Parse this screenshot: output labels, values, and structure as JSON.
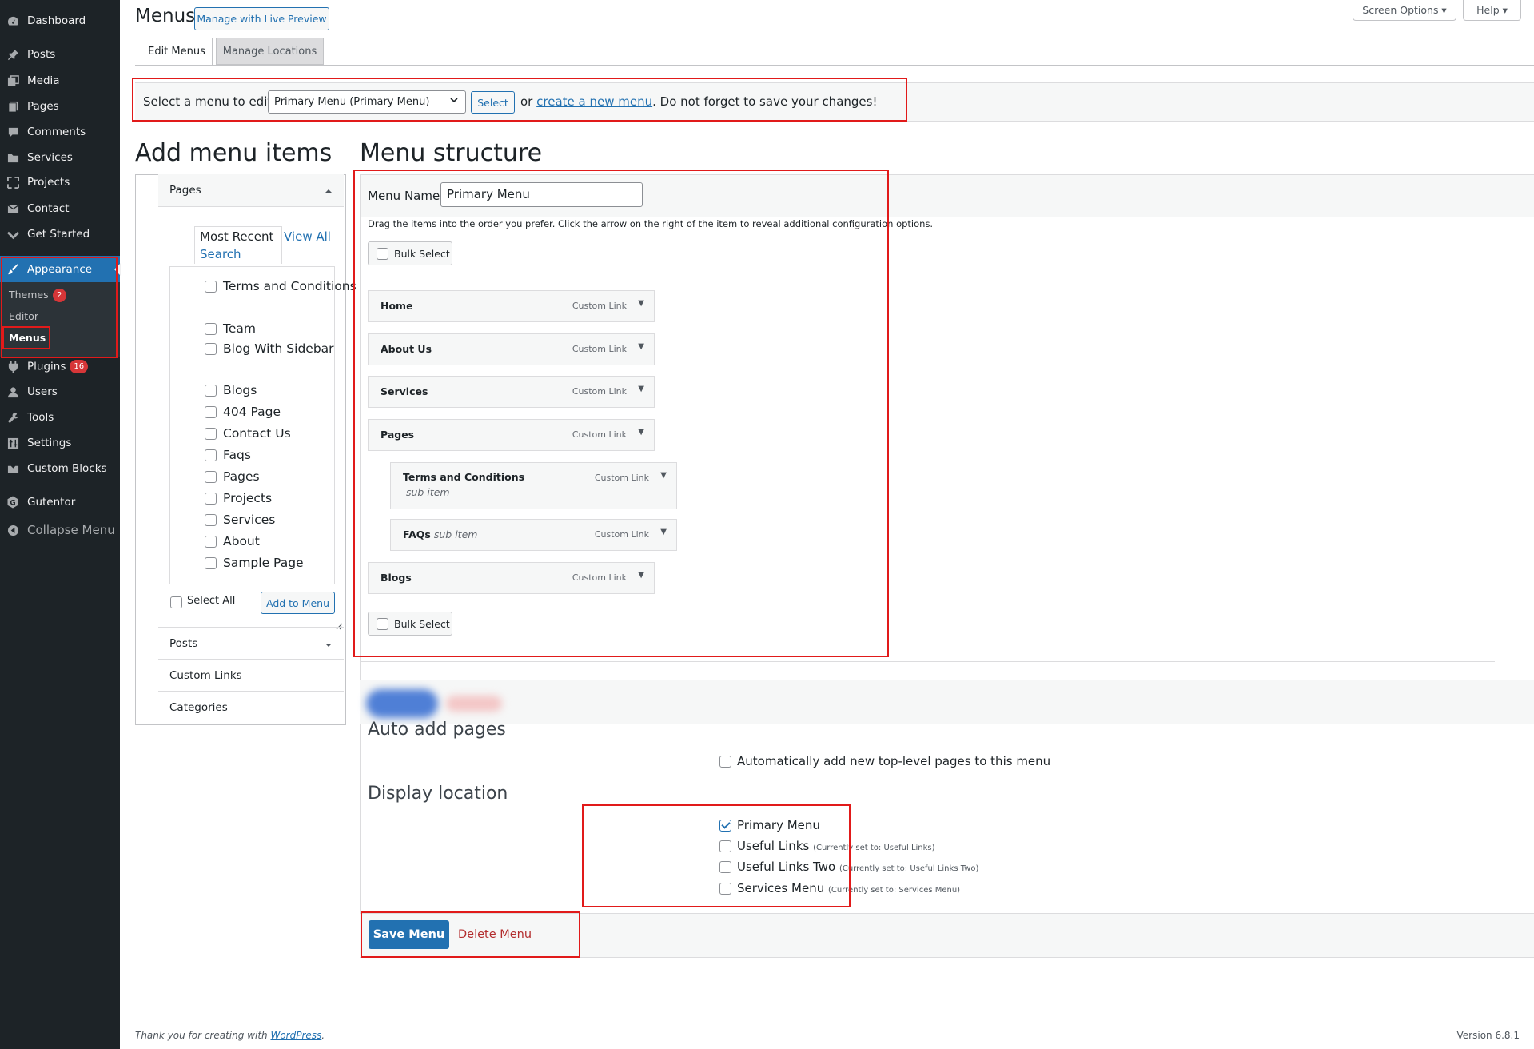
{
  "sidebar": {
    "items": [
      {
        "label": "Dashboard",
        "icon": "dashboard-icon"
      },
      {
        "label": "Posts",
        "icon": "pushpin-icon"
      },
      {
        "label": "Media",
        "icon": "media-icon"
      },
      {
        "label": "Pages",
        "icon": "pages-icon"
      },
      {
        "label": "Comments",
        "icon": "comment-icon"
      },
      {
        "label": "Services",
        "icon": "folder-icon"
      },
      {
        "label": "Projects",
        "icon": "expand-icon"
      },
      {
        "label": "Contact",
        "icon": "envelope-icon"
      },
      {
        "label": "Get Started",
        "icon": "chevron-down-icon"
      },
      {
        "label": "Appearance",
        "icon": "paintbrush-icon"
      },
      {
        "label": "Plugins",
        "icon": "plug-icon",
        "badge": "16"
      },
      {
        "label": "Users",
        "icon": "user-icon"
      },
      {
        "label": "Tools",
        "icon": "wrench-icon"
      },
      {
        "label": "Settings",
        "icon": "settings-icon"
      },
      {
        "label": "Custom Blocks",
        "icon": "blocks-icon"
      },
      {
        "label": "Gutentor",
        "icon": "gutentor-icon"
      },
      {
        "label": "Collapse Menu",
        "icon": "collapse-icon"
      }
    ],
    "submenu": [
      {
        "label": "Themes",
        "badge": "2"
      },
      {
        "label": "Editor"
      },
      {
        "label": "Menus",
        "current": true
      }
    ]
  },
  "header": {
    "title": "Menus",
    "live_preview_label": "Manage with Live Preview",
    "screen_options_label": "Screen Options ▾",
    "help_label": "Help ▾"
  },
  "tabs": {
    "edit": "Edit Menus",
    "locations": "Manage Locations"
  },
  "select_bar": {
    "label": "Select a menu to edit:",
    "selected": "Primary Menu (Primary Menu)",
    "select_button": "Select",
    "or_text": "or",
    "create_link": "create a new menu",
    "after_text": ". Do not forget to save your changes!"
  },
  "add_items": {
    "heading": "Add menu items",
    "pages_label": "Pages",
    "tab_recent": "Most Recent",
    "tab_all": "View All",
    "tab_search": "Search",
    "pages": [
      "Terms and Conditions",
      "Team",
      "Blog With Sidebar",
      "Blogs",
      "404 Page",
      "Contact Us",
      "Faqs",
      "Pages",
      "Projects",
      "Services",
      "About",
      "Sample Page"
    ],
    "select_all": "Select All",
    "add_button": "Add to Menu",
    "posts_label": "Posts",
    "custom_links_label": "Custom Links",
    "categories_label": "Categories"
  },
  "structure": {
    "heading": "Menu structure",
    "name_label": "Menu Name",
    "name_value": "Primary Menu",
    "instructions": "Drag the items into the order you prefer. Click the arrow on the right of the item to reveal additional configuration options.",
    "bulk_select": "Bulk Select",
    "items": [
      {
        "title": "Home",
        "type": "Custom Link",
        "sub": ""
      },
      {
        "title": "About Us",
        "type": "Custom Link",
        "sub": ""
      },
      {
        "title": "Services",
        "type": "Custom Link",
        "sub": ""
      },
      {
        "title": "Pages",
        "type": "Custom Link",
        "sub": ""
      },
      {
        "title": "Terms and Conditions",
        "type": "Custom Link",
        "sub": "sub item"
      },
      {
        "title": "FAQs",
        "type": "Custom Link",
        "sub": "sub item"
      },
      {
        "title": "Blogs",
        "type": "Custom Link",
        "sub": ""
      }
    ]
  },
  "settings": {
    "auto_add_heading": "Auto add pages",
    "auto_add_label": "Automatically add new top-level pages to this menu",
    "display_heading": "Display location",
    "locations": [
      {
        "label": "Primary Menu",
        "note": "",
        "checked": true
      },
      {
        "label": "Useful Links",
        "note": "(Currently set to: Useful Links)",
        "checked": false
      },
      {
        "label": "Useful Links Two",
        "note": "(Currently set to: Useful Links Two)",
        "checked": false
      },
      {
        "label": "Services Menu",
        "note": "(Currently set to: Services Menu)",
        "checked": false
      }
    ]
  },
  "footer_bar": {
    "save": "Save Menu",
    "delete": "Delete Menu"
  },
  "footer": {
    "thanks": "Thank you for creating with",
    "wp_link": "WordPress",
    "period": ".",
    "version": "Version 6.8.1"
  }
}
